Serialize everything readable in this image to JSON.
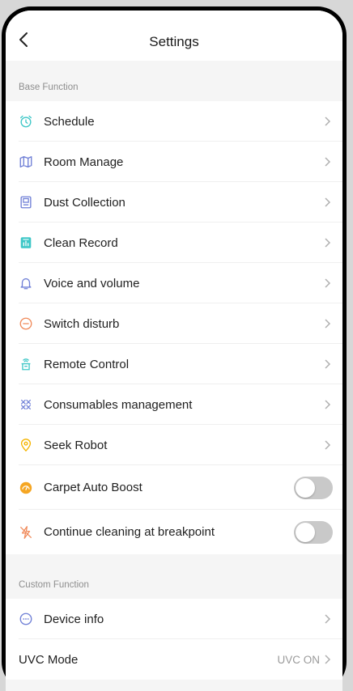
{
  "header": {
    "title": "Settings",
    "back_icon": "chevron-left-icon"
  },
  "base_section": {
    "label": "Base Function",
    "items": [
      {
        "label": "Schedule",
        "icon": "alarm-clock-icon",
        "color": "#3ec7c7"
      },
      {
        "label": "Room Manage",
        "icon": "map-icon",
        "color": "#6f7fd6"
      },
      {
        "label": "Dust Collection",
        "icon": "dust-station-icon",
        "color": "#6f7fd6"
      },
      {
        "label": "Clean Record",
        "icon": "record-document-icon",
        "color": "#3ec7c7"
      },
      {
        "label": "Voice and volume",
        "icon": "bell-icon",
        "color": "#6f7fd6"
      },
      {
        "label": "Switch disturb",
        "icon": "do-not-disturb-icon",
        "color": "#f08a5a"
      },
      {
        "label": "Remote Control",
        "icon": "remote-control-icon",
        "color": "#3ec7c7"
      },
      {
        "label": "Consumables management",
        "icon": "consumables-icon",
        "color": "#6f7fd6"
      },
      {
        "label": "Seek Robot",
        "icon": "location-pin-icon",
        "color": "#f5b400"
      }
    ],
    "toggles": [
      {
        "label": "Carpet Auto Boost",
        "icon": "carpet-boost-icon",
        "color": "#f5a623",
        "on": false
      },
      {
        "label": "Continue cleaning at breakpoint",
        "icon": "lightning-icon",
        "color": "#f08a5a",
        "on": false
      }
    ]
  },
  "custom_section": {
    "label": "Custom Function",
    "device_info": {
      "label": "Device info",
      "icon": "more-circle-icon",
      "color": "#6f7fd6"
    },
    "uvc": {
      "label": "UVC Mode",
      "value": "UVC ON"
    }
  },
  "colors": {
    "chevron": "#b0b0b0",
    "toggle_off": "#c9c9c9"
  }
}
